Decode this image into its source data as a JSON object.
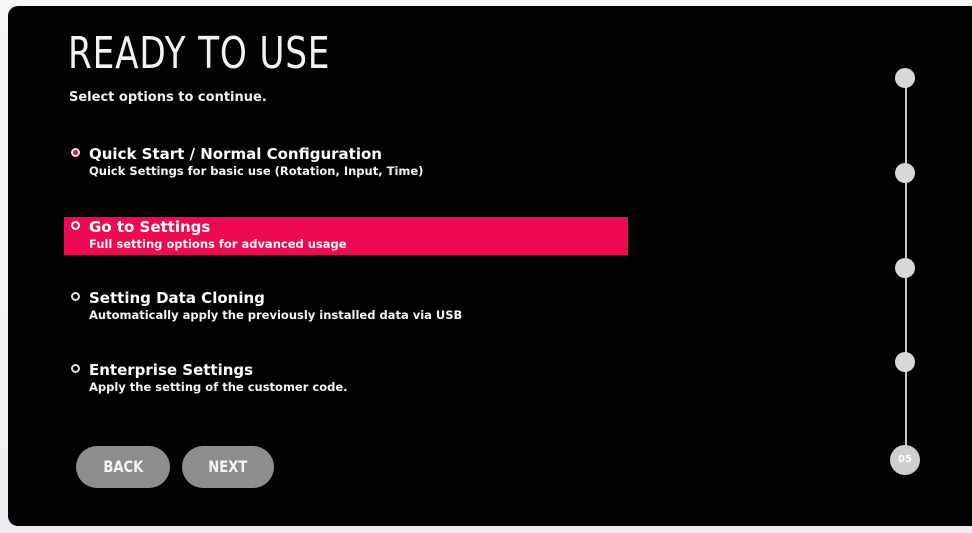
{
  "screen": {
    "title": "READY TO USE",
    "subtitle": "Select options to continue."
  },
  "options": [
    {
      "label": "Quick Start / Normal Configuration",
      "description": "Quick Settings for basic use (Rotation, Input, Time)",
      "selected": false
    },
    {
      "label": "Go to Settings",
      "description": "Full setting options for advanced usage",
      "selected": true
    },
    {
      "label": "Setting Data Cloning",
      "description": "Automatically apply the previously installed data via USB",
      "selected": false
    },
    {
      "label": "Enterprise Settings",
      "description": "Apply the setting of the customer code.",
      "selected": false
    }
  ],
  "buttons": {
    "back": "BACK",
    "next": "NEXT"
  },
  "progress": {
    "current_step_label": "05",
    "total_steps": 5,
    "current_step": 5
  },
  "colors": {
    "screen_background": "#020202",
    "selected_highlight": "#ee0a53",
    "button_fill": "#8d8d8d",
    "step_marker": "#d8d8d8",
    "text": "#ffffff"
  },
  "icons": {
    "option_marker": "radio-dot-icon",
    "step_marker": "step-circle-icon"
  }
}
